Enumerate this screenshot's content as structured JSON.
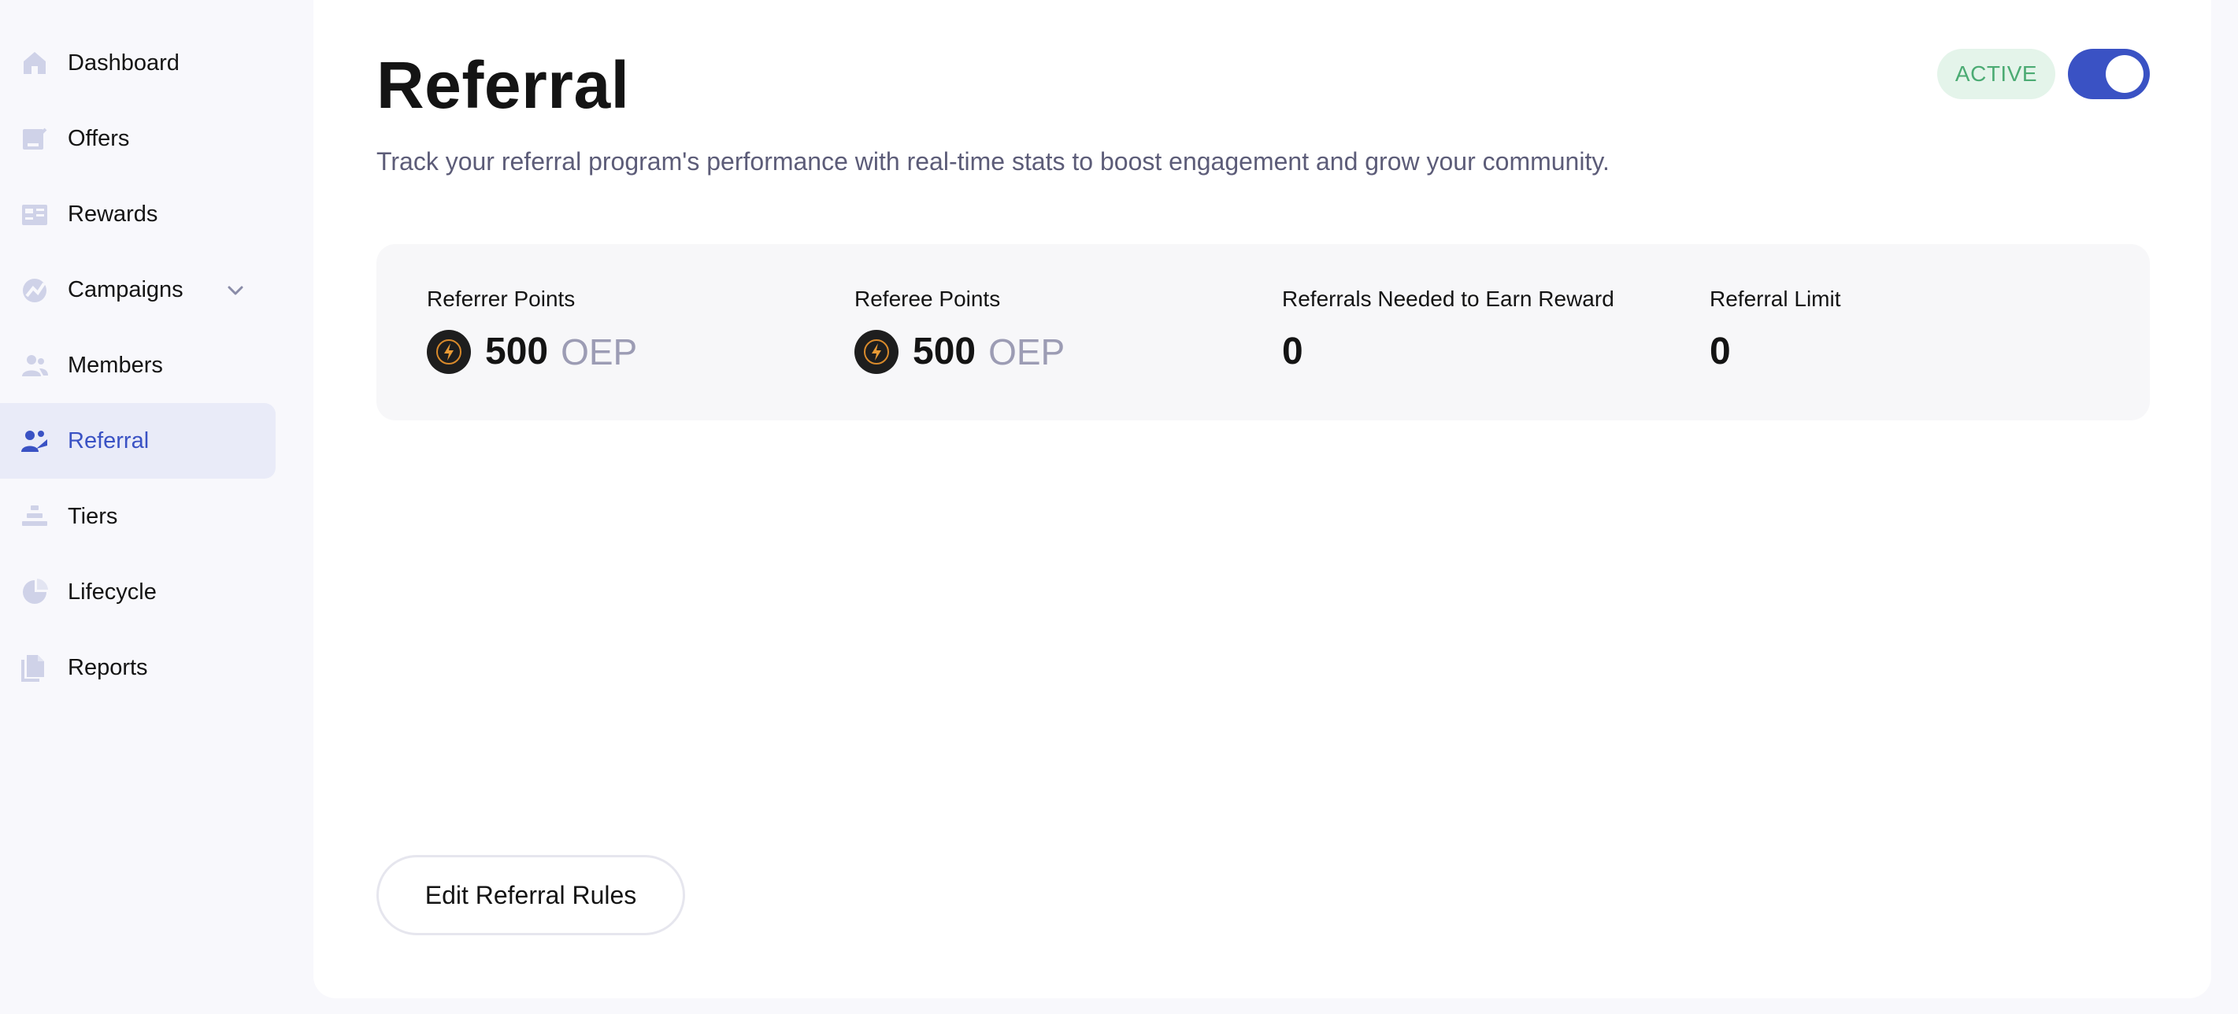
{
  "sidebar": {
    "items": [
      {
        "label": "Dashboard",
        "icon": "home-icon",
        "active": false
      },
      {
        "label": "Offers",
        "icon": "offers-icon",
        "active": false
      },
      {
        "label": "Rewards",
        "icon": "rewards-icon",
        "active": false
      },
      {
        "label": "Campaigns",
        "icon": "campaigns-icon",
        "active": false,
        "expandable": true
      },
      {
        "label": "Members",
        "icon": "members-icon",
        "active": false
      },
      {
        "label": "Referral",
        "icon": "referral-icon",
        "active": true
      },
      {
        "label": "Tiers",
        "icon": "tiers-icon",
        "active": false
      },
      {
        "label": "Lifecycle",
        "icon": "lifecycle-icon",
        "active": false
      },
      {
        "label": "Reports",
        "icon": "reports-icon",
        "active": false
      }
    ]
  },
  "header": {
    "title": "Referral",
    "subtitle": "Track your referral program's performance with real-time stats to boost engagement and grow your community.",
    "status": "ACTIVE",
    "toggle_on": true
  },
  "stats": [
    {
      "label": "Referrer Points",
      "value": "500",
      "unit": "OEP",
      "coin_icon": true
    },
    {
      "label": "Referee Points",
      "value": "500",
      "unit": "OEP",
      "coin_icon": true
    },
    {
      "label": "Referrals Needed to Earn Reward",
      "value": "0",
      "unit": "",
      "coin_icon": false
    },
    {
      "label": "Referral Limit",
      "value": "0",
      "unit": "",
      "coin_icon": false
    }
  ],
  "actions": {
    "edit_label": "Edit Referral Rules"
  },
  "colors": {
    "accent": "#3a52c4",
    "active_nav_bg": "#e9ebf8",
    "status_bg": "#e4f4ea",
    "status_text": "#4bab73",
    "icon_muted": "#cfd2e8",
    "unit_text": "#9c9cb4"
  }
}
